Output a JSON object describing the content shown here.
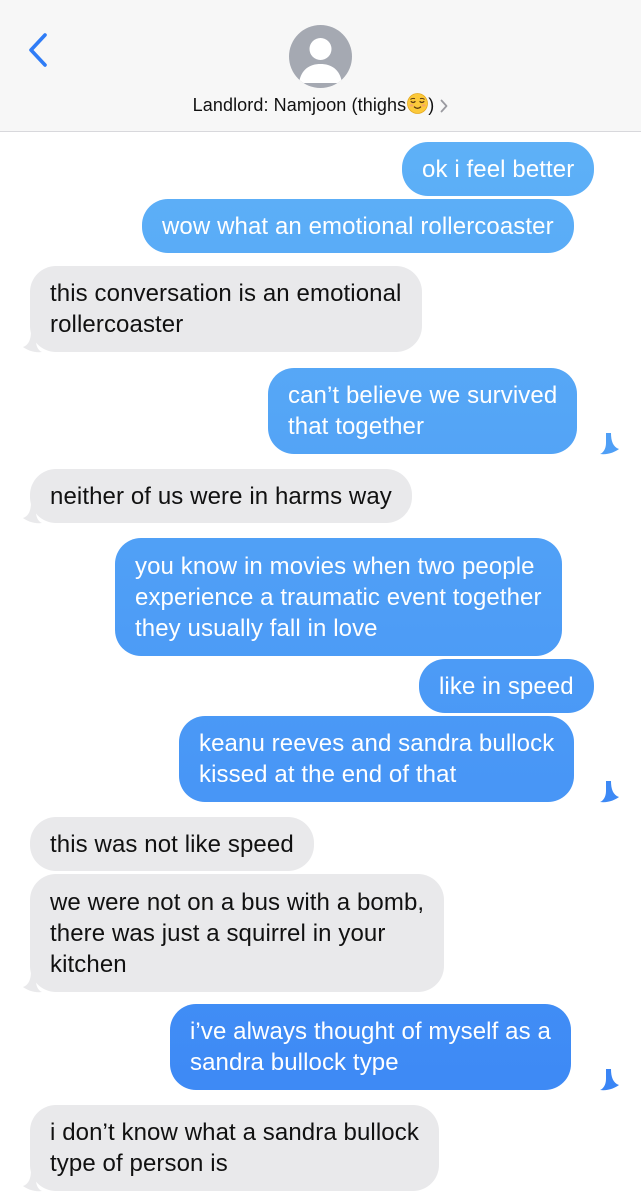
{
  "header": {
    "contact_name": "Landlord: Namjoon (thighs",
    "contact_name_suffix": ")",
    "emoji": "relieved-face"
  },
  "colors": {
    "sent_bubble_top": "#5eb1f7",
    "sent_bubble_bottom": "#3a85f5",
    "received_bubble": "#e9e9eb",
    "accent": "#2f7cf6"
  },
  "messages": [
    {
      "direction": "sent",
      "lines": [
        "ok i feel better"
      ]
    },
    {
      "direction": "sent",
      "lines": [
        "wow what an emotional rollercoaster"
      ]
    },
    {
      "direction": "received",
      "lines": [
        "this conversation is an emotional",
        "rollercoaster"
      ]
    },
    {
      "direction": "sent",
      "lines": [
        "can’t believe we survived",
        "that together"
      ]
    },
    {
      "direction": "received",
      "lines": [
        "neither of us were in harms way"
      ]
    },
    {
      "direction": "sent",
      "lines": [
        "you know in movies when two people",
        "experience a traumatic event together",
        "they usually fall in love"
      ]
    },
    {
      "direction": "sent",
      "lines": [
        "like in speed"
      ]
    },
    {
      "direction": "sent",
      "lines": [
        "keanu reeves and sandra bullock",
        "kissed at the end of that"
      ]
    },
    {
      "direction": "received",
      "lines": [
        "this was not like speed"
      ]
    },
    {
      "direction": "received",
      "lines": [
        "we were not on a bus with a bomb,",
        "there was just a squirrel in your",
        "kitchen"
      ]
    },
    {
      "direction": "sent",
      "lines": [
        "i’ve always thought of myself as a",
        "sandra bullock type"
      ]
    },
    {
      "direction": "received",
      "lines": [
        "i don’t know what a sandra bullock",
        "type of person is"
      ]
    }
  ]
}
